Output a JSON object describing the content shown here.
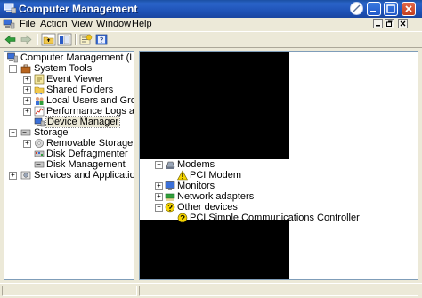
{
  "window": {
    "title": "Computer Management"
  },
  "menu": {
    "items": [
      "File",
      "Action",
      "View",
      "Window",
      "Help"
    ]
  },
  "icons": {
    "app": "computer-management-icon",
    "back": "back-arrow-icon",
    "forward": "forward-arrow-icon",
    "up": "up-folder-icon",
    "show_hide_tree": "console-tree-icon",
    "properties": "properties-icon",
    "help": "help-book-icon"
  },
  "left_tree": {
    "root": "Computer Management (Local)",
    "system_tools": "System Tools",
    "event_viewer": "Event Viewer",
    "shared_folders": "Shared Folders",
    "local_users": "Local Users and Groups",
    "perf_logs": "Performance Logs and Alerts",
    "device_manager": "Device Manager",
    "storage": "Storage",
    "removable_storage": "Removable Storage",
    "disk_defrag": "Disk Defragmenter",
    "disk_management": "Disk Management",
    "services_apps": "Services and Applications"
  },
  "device_tree": {
    "modems": "Modems",
    "pci_modem": "PCI Modem",
    "monitors": "Monitors",
    "network_adapters": "Network adapters",
    "other_devices": "Other devices",
    "pci_simple_comm": "PCI Simple Communications Controller"
  },
  "colors": {
    "titlebar": "#1d50b4",
    "face": "#ece9d8",
    "pane_border": "#7f9db9",
    "warning": "#f5d400"
  }
}
